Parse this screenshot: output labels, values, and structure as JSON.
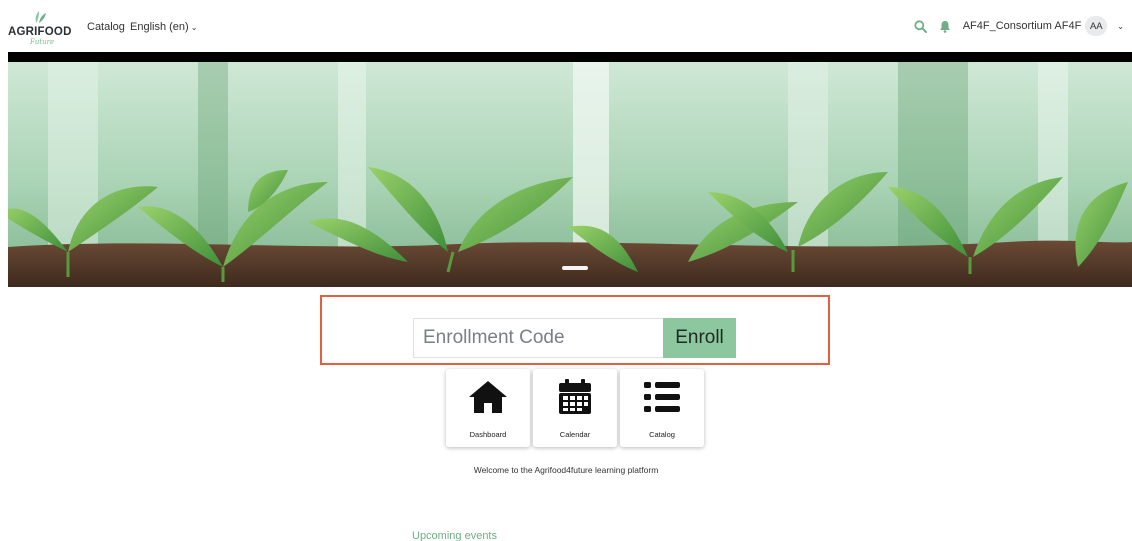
{
  "brand": {
    "logo_word": "AGRIFOOD",
    "logo_script": "Future",
    "accent_color": "#8cc7a0"
  },
  "nav": {
    "catalog_label": "Catalog",
    "language_label": "English (en)"
  },
  "user": {
    "name": "AF4F_Consortium AF4F",
    "initials": "AA"
  },
  "icons": {
    "search": "search-icon",
    "notifications": "bell-icon",
    "user_menu": "chevron-down-icon"
  },
  "enroll": {
    "placeholder": "Enrollment Code",
    "button_label": "Enroll",
    "highlight_color": "#e0603f"
  },
  "shortcuts": [
    {
      "label": "Dashboard",
      "icon": "home-icon"
    },
    {
      "label": "Calendar",
      "icon": "calendar-icon"
    },
    {
      "label": "Catalog",
      "icon": "list-icon"
    }
  ],
  "welcome_text": "Welcome to the Agrifood4future learning platform",
  "upcoming_events_label": "Upcoming events"
}
